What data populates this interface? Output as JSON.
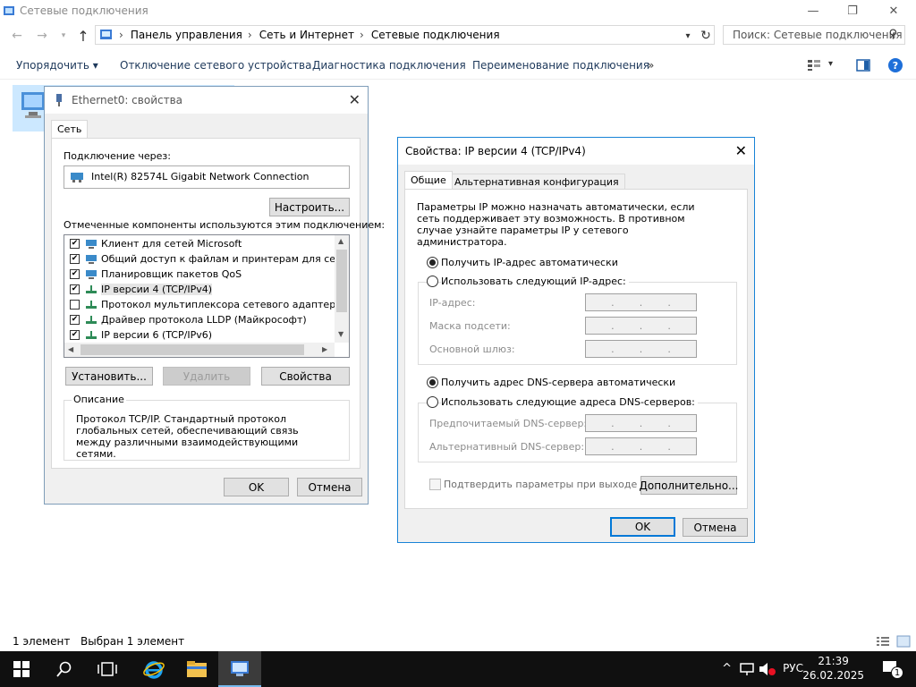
{
  "window": {
    "title": "Сетевые подключения",
    "minimize": "—",
    "maximize": "❐",
    "close": "✕"
  },
  "address": {
    "crumbs": [
      "Панель управления",
      "Сеть и Интернет",
      "Сетевые подключения"
    ],
    "search_placeholder": "Поиск: Сетевые подключения"
  },
  "toolbar": {
    "organize": "Упорядочить ▾",
    "disable": "Отключение сетевого устройства",
    "diagnose": "Диагностика подключения",
    "rename": "Переименование подключения",
    "more": "»"
  },
  "status": {
    "count": "1 элемент",
    "selected": "Выбран 1 элемент"
  },
  "taskbar": {
    "lang": "РУС",
    "time": "21:39",
    "date": "26.02.2025",
    "notif_count": "1"
  },
  "eth_dialog": {
    "title": "Ethernet0: свойства",
    "tab": "Сеть",
    "connect_via_label": "Подключение через:",
    "adapter": "Intel(R) 82574L Gigabit Network Connection",
    "configure": "Настроить...",
    "components_label": "Отмеченные компоненты используются этим подключением:",
    "components": [
      {
        "label": "Клиент для сетей Microsoft",
        "checked": "✔"
      },
      {
        "label": "Общий доступ к файлам и принтерам для сетей Mi",
        "checked": "✔"
      },
      {
        "label": "Планировщик пакетов QoS",
        "checked": "✔"
      },
      {
        "label": "IP версии 4 (TCP/IPv4)",
        "checked": "✔"
      },
      {
        "label": "Протокол мультиплексора сетевого адаптера (Май",
        "checked": ""
      },
      {
        "label": "Драйвер протокола LLDP (Майкрософт)",
        "checked": "✔"
      },
      {
        "label": "IP версии 6 (TCP/IPv6)",
        "checked": "✔"
      }
    ],
    "install": "Установить...",
    "remove": "Удалить",
    "properties": "Свойства",
    "desc_title": "Описание",
    "desc_text": "Протокол TCP/IP. Стандартный протокол глобальных сетей, обеспечивающий связь между различными взаимодействующими сетями.",
    "ok": "OK",
    "cancel": "Отмена"
  },
  "ipv4_dialog": {
    "title": "Свойства: IP версии 4 (TCP/IPv4)",
    "tab_general": "Общие",
    "tab_alt": "Альтернативная конфигурация",
    "intro": "Параметры IP можно назначать автоматически, если сеть поддерживает эту возможность. В противном случае узнайте параметры IP у сетевого администратора.",
    "auto_ip": "Получить IP-адрес автоматически",
    "manual_ip": "Использовать следующий IP-адрес:",
    "ip_label": "IP-адрес:",
    "mask_label": "Маска подсети:",
    "gateway_label": "Основной шлюз:",
    "auto_dns": "Получить адрес DNS-сервера автоматически",
    "manual_dns": "Использовать следующие адреса DNS-серверов:",
    "pref_dns_label": "Предпочитаемый DNS-сервер:",
    "alt_dns_label": "Альтернативный DNS-сервер:",
    "validate": "Подтвердить параметры при выходе",
    "advanced": "Дополнительно...",
    "ok": "OK",
    "cancel": "Отмена"
  }
}
